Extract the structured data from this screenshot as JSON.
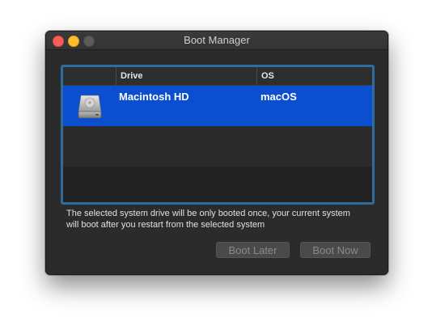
{
  "window": {
    "title": "Boot Manager"
  },
  "table": {
    "columns": [
      "",
      "Drive",
      "OS"
    ],
    "rows": [
      {
        "icon": "hard-drive-icon",
        "drive": "Macintosh HD",
        "os": "macOS",
        "selected": true
      }
    ]
  },
  "hint": "The selected system drive will be only booted once, your current system will boot after you restart from the selected system",
  "buttons": {
    "boot_later": "Boot Later",
    "boot_now": "Boot Now"
  },
  "colors": {
    "selection": "#0b4fd1",
    "focus_ring": "#2f6c9e",
    "close": "#fc5f57",
    "minimize": "#fdbc2e"
  }
}
